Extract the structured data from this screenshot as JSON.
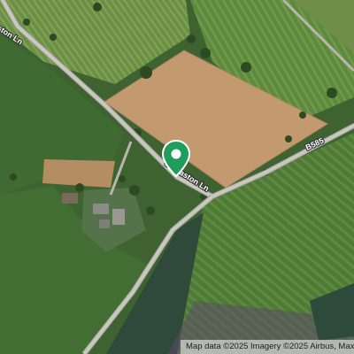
{
  "map": {
    "roads": [
      {
        "name": "Osmaston Ln"
      },
      {
        "name": "B585"
      }
    ],
    "top_left_label": "ston Ln",
    "main_label": "Osmaston Ln",
    "b_road_label": "B585",
    "marker": {
      "icon": "location-pin-icon",
      "color": "#1f9d5b"
    },
    "attribution": "Map data ©2025 Imagery ©2025 Airbus, Max"
  }
}
